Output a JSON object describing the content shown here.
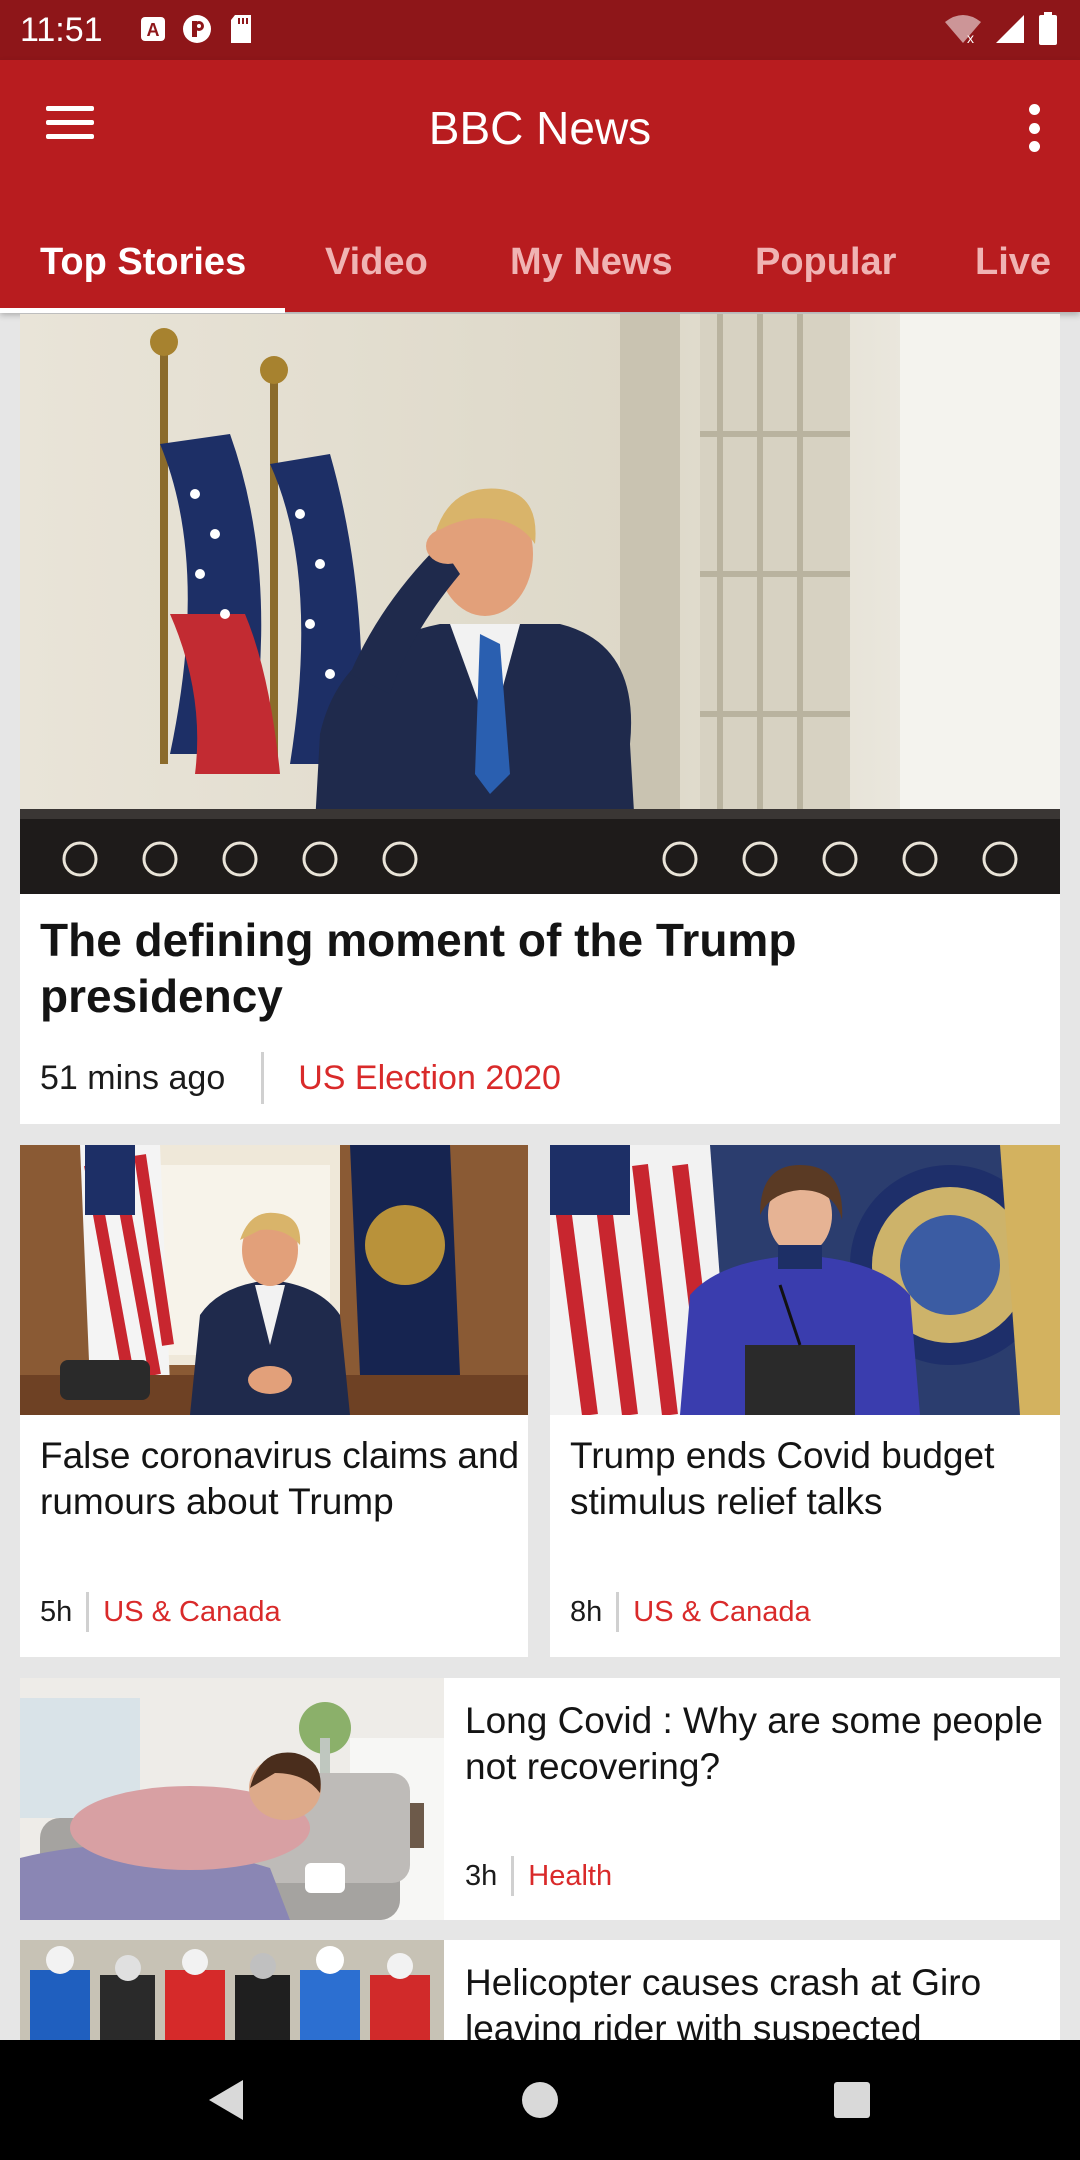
{
  "status_bar": {
    "time": "11:51",
    "icons": [
      "a-badge-icon",
      "p-circle-icon",
      "sd-card-icon"
    ],
    "right_icons": [
      "wifi-icon",
      "signal-icon",
      "battery-icon"
    ]
  },
  "app_bar": {
    "title": "BBC News",
    "tabs": [
      {
        "label": "Top Stories",
        "active": true
      },
      {
        "label": "Video",
        "active": false
      },
      {
        "label": "My News",
        "active": false
      },
      {
        "label": "Popular",
        "active": false
      },
      {
        "label": "Live",
        "active": false
      }
    ]
  },
  "stories": {
    "lead": {
      "headline": "The defining moment of the Trump presidency",
      "time": "51 mins ago",
      "category": "US Election 2020"
    },
    "grid": [
      {
        "headline": "False coronavirus claims and rumours about Trump",
        "time": "5h",
        "category": "US & Canada"
      },
      {
        "headline": "Trump ends Covid budget stimulus relief talks",
        "time": "8h",
        "category": "US & Canada"
      }
    ],
    "list": [
      {
        "headline": "Long Covid : Why are some people not recovering?",
        "time": "3h",
        "category": "Health"
      },
      {
        "headline": "Helicopter causes crash at Giro leaving rider with suspected",
        "time": "",
        "category": ""
      }
    ]
  },
  "colors": {
    "app_bar": "#b81c1f",
    "status_bar": "#8e1619",
    "category": "#d92a2a",
    "background": "#e6e6e6"
  }
}
